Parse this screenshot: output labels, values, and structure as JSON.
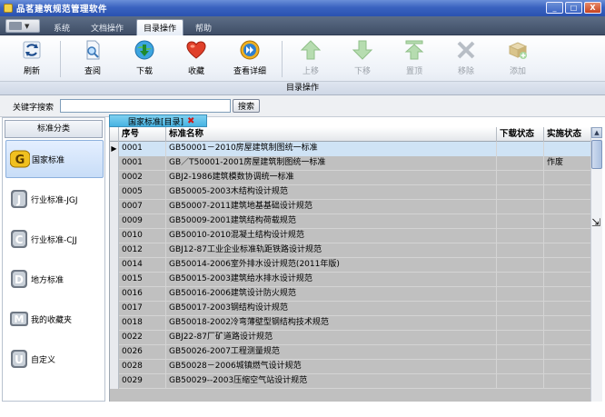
{
  "window": {
    "title": "品茗建筑规范管理软件",
    "minimize_glyph": "_",
    "maximize_glyph": "□",
    "close_glyph": "X"
  },
  "ribbon_tabs": [
    {
      "label": "系统",
      "active": false
    },
    {
      "label": "文档操作",
      "active": false
    },
    {
      "label": "目录操作",
      "active": true
    },
    {
      "label": "帮助",
      "active": false
    }
  ],
  "toolbar": {
    "group_caption": "目录操作",
    "buttons": [
      {
        "label": "刷新",
        "icon": "refresh-icon",
        "enabled": true
      },
      {
        "label": "查阅",
        "icon": "document-view-icon",
        "enabled": true
      },
      {
        "label": "下载",
        "icon": "download-globe-icon",
        "enabled": true
      },
      {
        "label": "收藏",
        "icon": "heart-favorite-icon",
        "enabled": true
      },
      {
        "label": "查看详细",
        "icon": "forward-detail-icon",
        "enabled": true
      },
      {
        "label": "上移",
        "icon": "arrow-up-icon",
        "enabled": false
      },
      {
        "label": "下移",
        "icon": "arrow-down-icon",
        "enabled": false
      },
      {
        "label": "置顶",
        "icon": "arrow-top-icon",
        "enabled": false
      },
      {
        "label": "移除",
        "icon": "remove-x-icon",
        "enabled": false
      },
      {
        "label": "添加",
        "icon": "add-book-icon",
        "enabled": false
      }
    ]
  },
  "search": {
    "label": "关键字搜索",
    "value": "",
    "button": "搜索"
  },
  "categories": {
    "header": "标准分类",
    "items": [
      {
        "label": "国家标准",
        "letter": "G",
        "active": true
      },
      {
        "label": "行业标准-JGJ",
        "letter": "J",
        "active": false
      },
      {
        "label": "行业标准-CJJ",
        "letter": "C",
        "active": false
      },
      {
        "label": "地方标准",
        "letter": "D",
        "active": false
      },
      {
        "label": "我的收藏夹",
        "letter": "M",
        "active": false
      },
      {
        "label": "自定义",
        "letter": "U",
        "active": false
      }
    ]
  },
  "doc_tab": {
    "label": "国家标准[目录]",
    "close_glyph": "✖"
  },
  "grid": {
    "columns": [
      "序号",
      "标准名称",
      "下载状态",
      "实施状态"
    ],
    "current_marker": "▶",
    "rows": [
      {
        "no": "0001",
        "name": "GB50001－2010房屋建筑制图统一标准",
        "download": "",
        "status": ""
      },
      {
        "no": "0001",
        "name": "GB／T50001-2001房屋建筑制图统一标准",
        "download": "",
        "status": "作废"
      },
      {
        "no": "0002",
        "name": "GBJ2-1986建筑模数协调统一标准",
        "download": "",
        "status": ""
      },
      {
        "no": "0005",
        "name": "GB50005-2003木结构设计规范",
        "download": "",
        "status": ""
      },
      {
        "no": "0007",
        "name": "GB50007-2011建筑地基基础设计规范",
        "download": "",
        "status": ""
      },
      {
        "no": "0009",
        "name": "GB50009-2001建筑结构荷载规范",
        "download": "",
        "status": ""
      },
      {
        "no": "0010",
        "name": "GB50010-2010混凝土结构设计规范",
        "download": "",
        "status": ""
      },
      {
        "no": "0012",
        "name": "GBJ12-87工业企业标准轨距铁路设计规范",
        "download": "",
        "status": ""
      },
      {
        "no": "0014",
        "name": "GB50014-2006室外排水设计规范(2011年版)",
        "download": "",
        "status": ""
      },
      {
        "no": "0015",
        "name": "GB50015-2003建筑给水排水设计规范",
        "download": "",
        "status": ""
      },
      {
        "no": "0016",
        "name": "GB50016-2006建筑设计防火规范",
        "download": "",
        "status": ""
      },
      {
        "no": "0017",
        "name": "GB50017-2003钢结构设计规范",
        "download": "",
        "status": ""
      },
      {
        "no": "0018",
        "name": "GB50018-2002冷弯薄壁型钢结构技术规范",
        "download": "",
        "status": ""
      },
      {
        "no": "0022",
        "name": "GBJ22-87厂矿道路设计规范",
        "download": "",
        "status": ""
      },
      {
        "no": "0026",
        "name": "GB50026-2007工程测量规范",
        "download": "",
        "status": ""
      },
      {
        "no": "0028",
        "name": "GB50028－2006城镇燃气设计规范",
        "download": "",
        "status": ""
      },
      {
        "no": "0029",
        "name": "GB50029--2003压缩空气站设计规范",
        "download": "",
        "status": ""
      }
    ]
  },
  "colors": {
    "titlebar": "#3a63c0",
    "tabsbar": "#4f5f78",
    "doc_tab": "#47b3e2",
    "grid_bg": "#c0c0c0",
    "selected_row": "#cfe3f5"
  }
}
